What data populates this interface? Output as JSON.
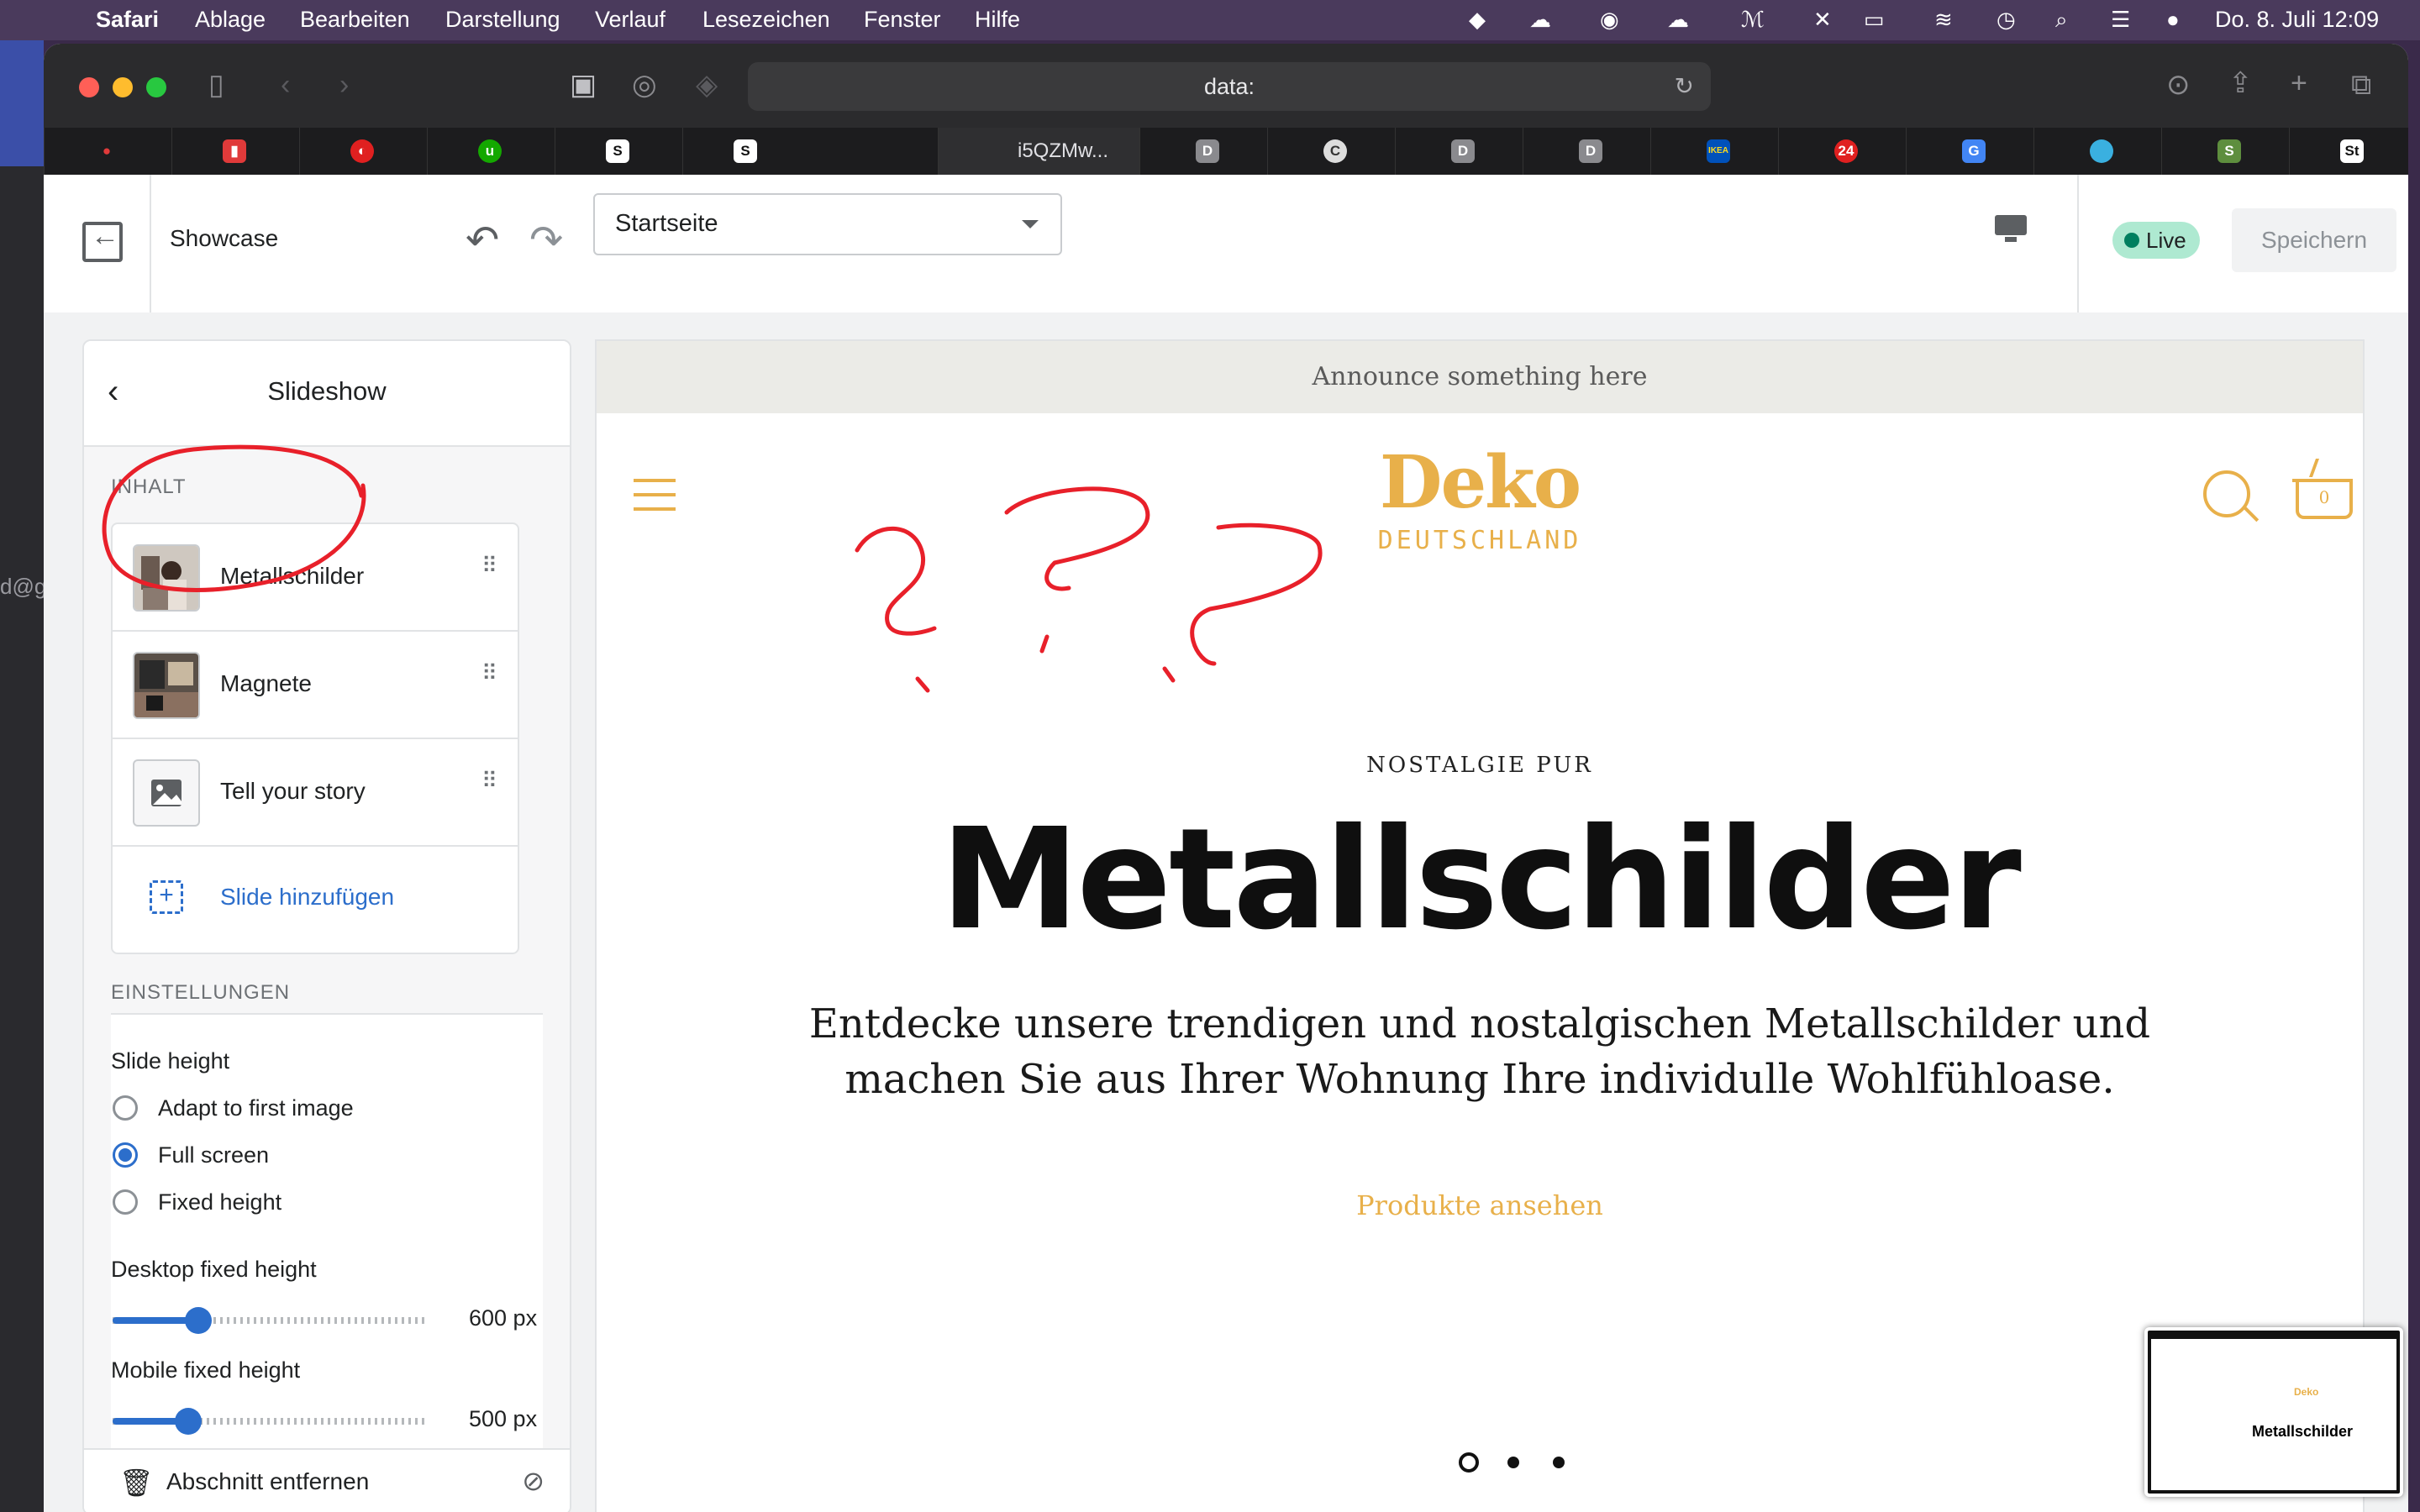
{
  "menubar": {
    "app": "Safari",
    "items": [
      "Ablage",
      "Bearbeiten",
      "Darstellung",
      "Verlauf",
      "Lesezeichen",
      "Fenster",
      "Hilfe"
    ],
    "datetime": "Do. 8. Juli  12:09"
  },
  "desktop": {
    "partial_text": "d@g"
  },
  "browser": {
    "url": "data:",
    "active_tab_label": "i5QZMw..."
  },
  "editor": {
    "theme_name": "Showcase",
    "page_select": "Startseite",
    "status": "Live",
    "save_label": "Speichern"
  },
  "sidebar": {
    "title": "Slideshow",
    "content_label": "INHALT",
    "blocks": [
      {
        "label": "Metallschilder"
      },
      {
        "label": "Magnete"
      },
      {
        "label": "Tell your story"
      }
    ],
    "add_slide_label": "Slide hinzufügen",
    "settings_label": "EINSTELLUNGEN",
    "slide_height_label": "Slide height",
    "slide_height_options": [
      "Adapt to first image",
      "Full screen",
      "Fixed height"
    ],
    "slide_height_selected": "Full screen",
    "desktop_height_label": "Desktop fixed height",
    "desktop_height_value": "600 px",
    "desktop_height_fraction": 0.27,
    "mobile_height_label": "Mobile fixed height",
    "mobile_height_value": "500 px",
    "mobile_height_fraction": 0.24,
    "remove_section_label": "Abschnitt entfernen"
  },
  "preview": {
    "announcement": "Announce something here",
    "logo_main": "Deko",
    "logo_sub": "DEUTSCHLAND",
    "cart_count": "0",
    "eyebrow": "NOSTALGIE PUR",
    "title": "Metallschilder",
    "text": "Entdecke unsere trendigen und nostalgischen Metallschilder und machen Sie aus Ihrer Wohnung Ihre individulle Wohlfühloase.",
    "cta": "Produkte ansehen",
    "slide_count": 3,
    "active_slide": 1,
    "brand_color": "#e8b04a"
  },
  "thumbnail": {
    "title": "Metallschilder",
    "logo": "Deko"
  },
  "annotation_color": "#e8202a"
}
